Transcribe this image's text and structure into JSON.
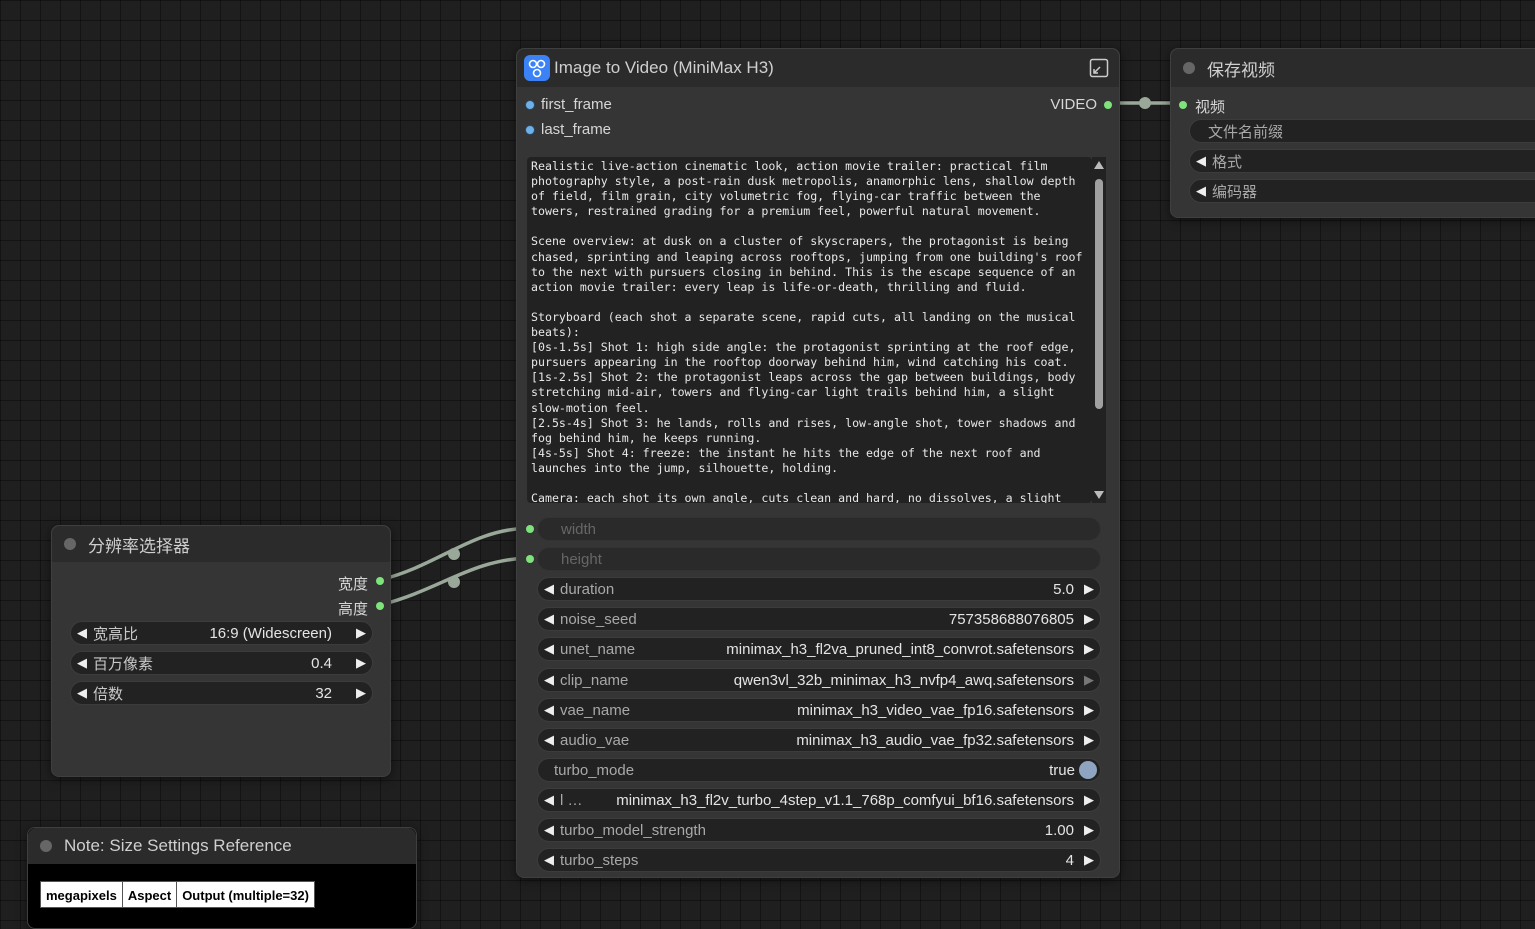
{
  "main_node": {
    "title": "Image to Video (MiniMax H3)",
    "inputs": [
      "first_frame",
      "last_frame"
    ],
    "output": "VIDEO",
    "prompt": "Realistic live-action cinematic look, action movie trailer: practical film photography style, a post-rain dusk metropolis, anamorphic lens, shallow depth of field, film grain, city volumetric fog, flying-car traffic between the towers, restrained grading for a premium feel, powerful natural movement.\n\nScene overview: at dusk on a cluster of skyscrapers, the protagonist is being chased, sprinting and leaping across rooftops, jumping from one building's roof to the next with pursuers closing in behind. This is the escape sequence of an action movie trailer: every leap is life-or-death, thrilling and fluid.\n\nStoryboard (each shot a separate scene, rapid cuts, all landing on the musical beats):\n[0s-1.5s] Shot 1: high side angle: the protagonist sprinting at the roof edge, pursuers appearing in the rooftop doorway behind him, wind catching his coat.\n[1s-2.5s] Shot 2: the protagonist leaps across the gap between buildings, body stretching mid-air, towers and flying-car light trails behind him, a slight slow-motion feel.\n[2.5s-4s] Shot 3: he lands, rolls and rises, low-angle shot, tower shadows and fog behind him, he keeps running.\n[4s-5s] Shot 4: freeze: the instant he hits the edge of the next roof and launches into the jump, silhouette, holding.\n\nCamera: each shot its own angle, cuts clean and hard, no dissolves, a slight",
    "link_widgets": [
      {
        "name": "width"
      },
      {
        "name": "height"
      }
    ],
    "widgets": [
      {
        "name": "duration",
        "value": "5.0"
      },
      {
        "name": "noise_seed",
        "value": "757358688076805"
      },
      {
        "name": "unet_name",
        "value": "minimax_h3_fl2va_pruned_int8_convrot.safetensors"
      },
      {
        "name": "clip_name",
        "value": "qwen3vl_32b_minimax_h3_nvfp4_awq.safetensors"
      },
      {
        "name": "vae_name",
        "value": "minimax_h3_video_vae_fp16.safetensors"
      },
      {
        "name": "audio_vae",
        "value": "minimax_h3_audio_vae_fp32.safetensors"
      }
    ],
    "turbo_mode": {
      "name": "turbo_mode",
      "value": "true"
    },
    "lora": {
      "name": "l …",
      "value": "minimax_h3_fl2v_turbo_4step_v1.1_768p_comfyui_bf16.safetensors"
    },
    "widgets2": [
      {
        "name": "turbo_model_strength",
        "value": "1.00"
      },
      {
        "name": "turbo_steps",
        "value": "4"
      }
    ]
  },
  "save_node": {
    "title": "保存视频",
    "input": "视频",
    "widgets": [
      "文件名前缀",
      "格式",
      "编码器"
    ]
  },
  "res_node": {
    "title": "分辨率选择器",
    "outputs": [
      "宽度",
      "高度"
    ],
    "widgets": [
      {
        "name": "宽高比",
        "value": "16:9 (Widescreen)"
      },
      {
        "name": "百万像素",
        "value": "0.4"
      },
      {
        "name": "倍数",
        "value": "32"
      }
    ]
  },
  "note_node": {
    "title": "Note: Size Settings Reference",
    "table_headers": [
      "megapixels",
      "Aspect",
      "Output (multiple=32)"
    ]
  },
  "colors": {
    "canvas": "#1f1f1f",
    "node": "#353535",
    "header": "#2b2b2b",
    "link": "#9aa89a",
    "slot_green": "#7ee37a",
    "slot_blue": "#6fb0e8",
    "accent_icon": "#3b82f6"
  },
  "icons": [
    "workflow-icon",
    "expand-icon"
  ]
}
